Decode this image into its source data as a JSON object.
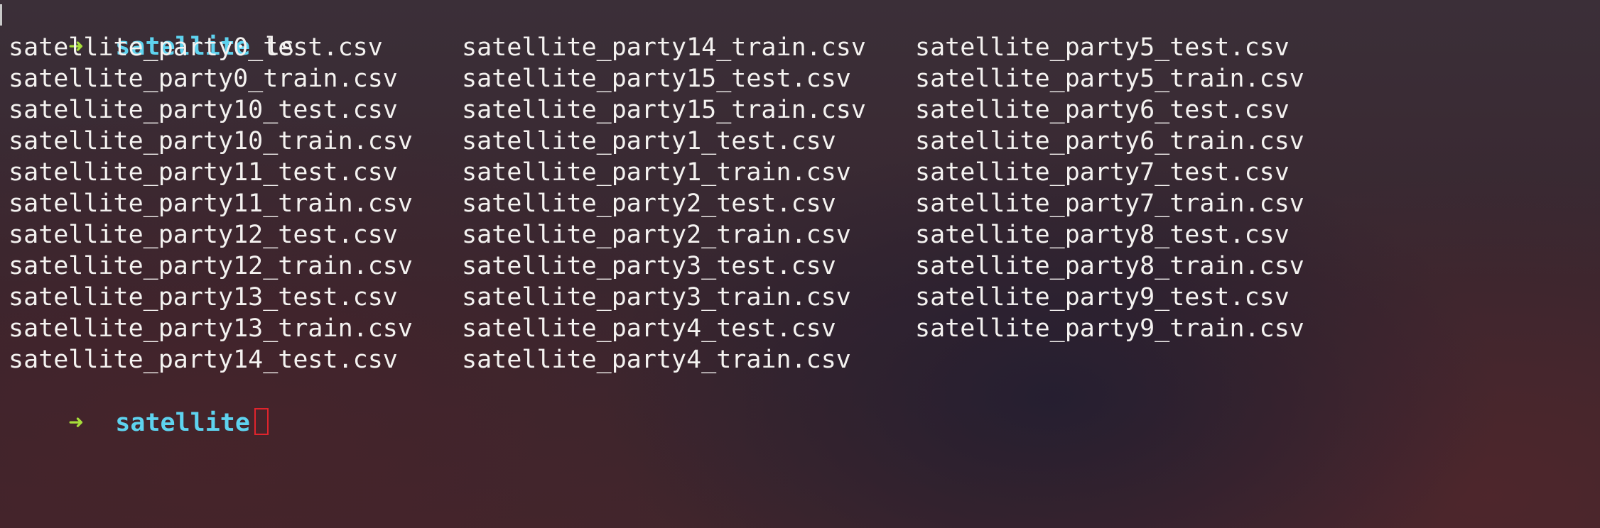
{
  "terminal": {
    "prompt_symbol": "➜",
    "directory": "satellite",
    "command": "ls",
    "files": [
      "satellite_party0_test.csv",
      "satellite_party0_train.csv",
      "satellite_party10_test.csv",
      "satellite_party10_train.csv",
      "satellite_party11_test.csv",
      "satellite_party11_train.csv",
      "satellite_party12_test.csv",
      "satellite_party12_train.csv",
      "satellite_party13_test.csv",
      "satellite_party13_train.csv",
      "satellite_party14_test.csv",
      "satellite_party14_train.csv",
      "satellite_party15_test.csv",
      "satellite_party15_train.csv",
      "satellite_party1_test.csv",
      "satellite_party1_train.csv",
      "satellite_party2_test.csv",
      "satellite_party2_train.csv",
      "satellite_party3_test.csv",
      "satellite_party3_train.csv",
      "satellite_party4_test.csv",
      "satellite_party4_train.csv",
      "satellite_party5_test.csv",
      "satellite_party5_train.csv",
      "satellite_party6_test.csv",
      "satellite_party6_train.csv",
      "satellite_party7_test.csv",
      "satellite_party7_train.csv",
      "satellite_party8_test.csv",
      "satellite_party8_train.csv",
      "satellite_party9_test.csv",
      "satellite_party9_train.csv"
    ]
  },
  "colors": {
    "prompt_arrow": "#a6dd3a",
    "directory": "#5ed3ef",
    "cursor_outline": "#e0242c",
    "text": "#f4f2f0"
  }
}
